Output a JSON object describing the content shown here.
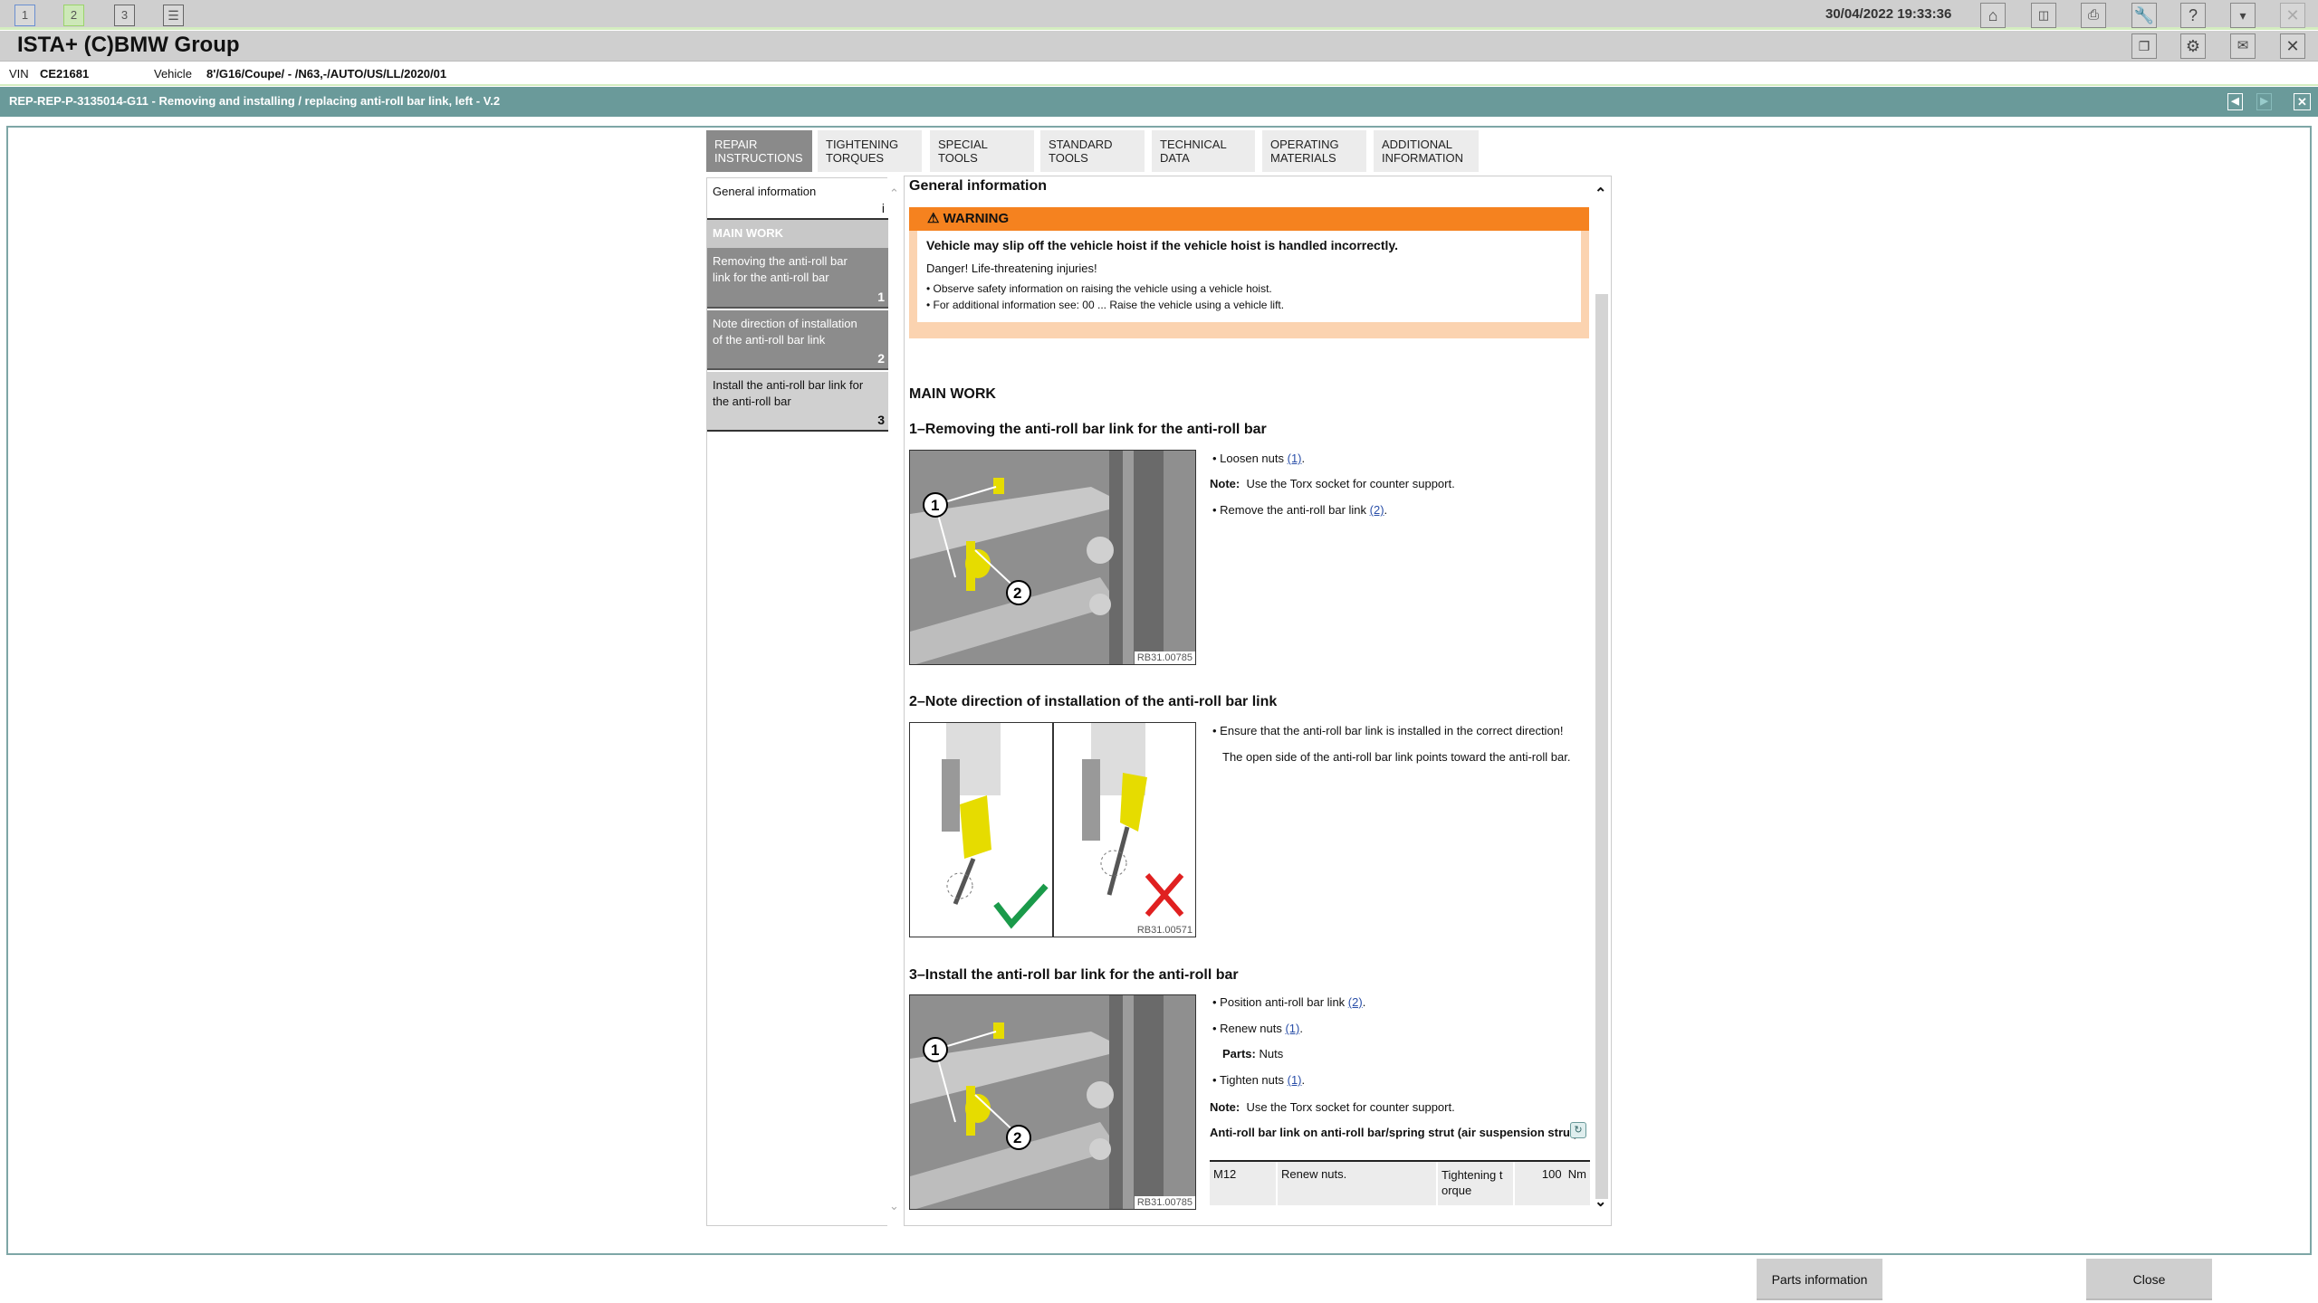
{
  "topbar": {
    "sessions": [
      "1",
      "2",
      "3"
    ],
    "datetime": "30/04/2022 19:33:36",
    "icons": [
      "home-icon",
      "split-view-icon",
      "print-icon",
      "wrench-icon",
      "help-icon",
      "minimize-icon",
      "close-icon"
    ]
  },
  "app": {
    "title": "ISTA+ (C)BMW Group",
    "icons": [
      "copy-document-icon",
      "gear-icon",
      "mail-icon",
      "close-icon"
    ]
  },
  "vehicle": {
    "vin_label": "VIN",
    "vin": "CE21681",
    "vehicle_label": "Vehicle",
    "vehicle": "8'/G16/Coupe/ - /N63,-/AUTO/US/LL/2020/01"
  },
  "document": {
    "title": "REP-REP-P-3135014-G11 - Removing and installing / replacing anti-roll bar link, left - V.2"
  },
  "tabs": [
    {
      "l1": "REPAIR",
      "l2": "INSTRUCTIONS"
    },
    {
      "l1": "TIGHTENING",
      "l2": "TORQUES"
    },
    {
      "l1": "SPECIAL TOOLS",
      "l2": ""
    },
    {
      "l1": "STANDARD",
      "l2": "TOOLS"
    },
    {
      "l1": "TECHNICAL",
      "l2": "DATA"
    },
    {
      "l1": "OPERATING",
      "l2": "MATERIALS"
    },
    {
      "l1": "ADDITIONAL",
      "l2": "INFORMATION"
    }
  ],
  "nav": {
    "general": "General information",
    "general_marker": "i",
    "section": "MAIN WORK",
    "items": [
      {
        "label": "Removing the anti-roll bar link for the anti-roll bar",
        "num": "1"
      },
      {
        "label": "Note direction of installation of the anti-roll bar link",
        "num": "2"
      },
      {
        "label": "Install the anti-roll bar link for the anti-roll bar",
        "num": "3"
      }
    ]
  },
  "content": {
    "general_heading": "General information",
    "warning": {
      "label": "WARNING",
      "headline": "Vehicle may slip off the vehicle hoist if the vehicle hoist is handled incorrectly.",
      "danger": "Danger! Life-threatening injuries!",
      "bullets": [
        "Observe safety information on raising the vehicle using a vehicle hoist.",
        "For additional information see: 00 ... Raise the vehicle using a vehicle lift."
      ],
      "color": "#f5821f"
    },
    "main_work": "MAIN WORK",
    "step1": {
      "heading": "1–Removing the anti-roll bar link for the anti-roll bar",
      "image_code": "RB31.00785",
      "b1": "Loosen nuts ",
      "b1_link": "(1)",
      "b1_end": ".",
      "note_label": "Note:",
      "note": "Use the Torx socket for counter support.",
      "b2": "Remove the anti-roll bar link ",
      "b2_link": "(2)",
      "b2_end": "."
    },
    "step2": {
      "heading": "2–Note direction of installation of the anti-roll bar link",
      "image_code": "RB31.00571",
      "b1": "Ensure that the anti-roll bar link is installed in the correct direction!",
      "p": "The open side of the anti-roll bar link points toward the anti-roll bar."
    },
    "step3": {
      "heading": "3–Install the anti-roll bar link for the anti-roll bar",
      "image_code": "RB31.00785",
      "b1": "Position anti-roll bar link ",
      "b1_link": "(2)",
      "b2": "Renew nuts ",
      "b2_link": "(1)",
      "parts_label": "Parts:",
      "parts": "Nuts",
      "b3": "Tighten nuts ",
      "b3_link": "(1)",
      "note_label": "Note:",
      "note": "Use the Torx socket for counter support.",
      "torque_title": "Anti-roll bar link on anti-roll bar/spring strut (air suspension strut)",
      "torque_row": [
        "M12",
        "Renew nuts.",
        "Tightening t orque",
        "100  Nm"
      ]
    }
  },
  "buttons": {
    "parts": "Parts information",
    "close": "Close"
  }
}
